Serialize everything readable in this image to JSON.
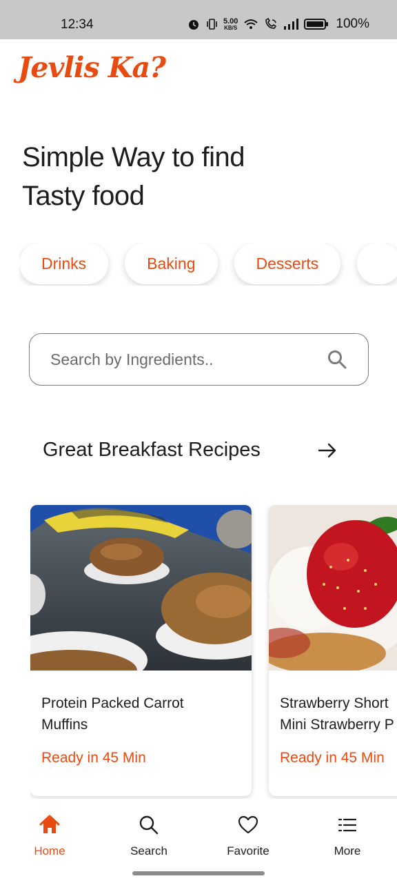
{
  "status_bar": {
    "time": "12:34",
    "net_speed_value": "5.00",
    "net_speed_unit": "KB/S",
    "battery": "100%"
  },
  "app": {
    "logo": "Jevlis Ka?",
    "accent_color": "#e84a10"
  },
  "headline": {
    "line1": "Simple Way to find",
    "line2": "Tasty food"
  },
  "categories": [
    "Drinks",
    "Baking",
    "Desserts"
  ],
  "search": {
    "placeholder": "Search by Ingredients..",
    "icon": "search-icon"
  },
  "section": {
    "title": "Great Breakfast Recipes",
    "arrow_icon": "arrow-right-icon"
  },
  "recipes": [
    {
      "title_line1": "Protein Packed Carrot",
      "title_line2": "Muffins",
      "time": "Ready in 45 Min"
    },
    {
      "title_line1": "Strawberry Short",
      "title_line2": "Mini Strawberry P",
      "time": "Ready in 45 Min"
    }
  ],
  "bottom_nav": [
    {
      "label": "Home",
      "icon": "home-icon",
      "active": true
    },
    {
      "label": "Search",
      "icon": "search-icon",
      "active": false
    },
    {
      "label": "Favorite",
      "icon": "heart-icon",
      "active": false
    },
    {
      "label": "More",
      "icon": "menu-icon",
      "active": false
    }
  ]
}
